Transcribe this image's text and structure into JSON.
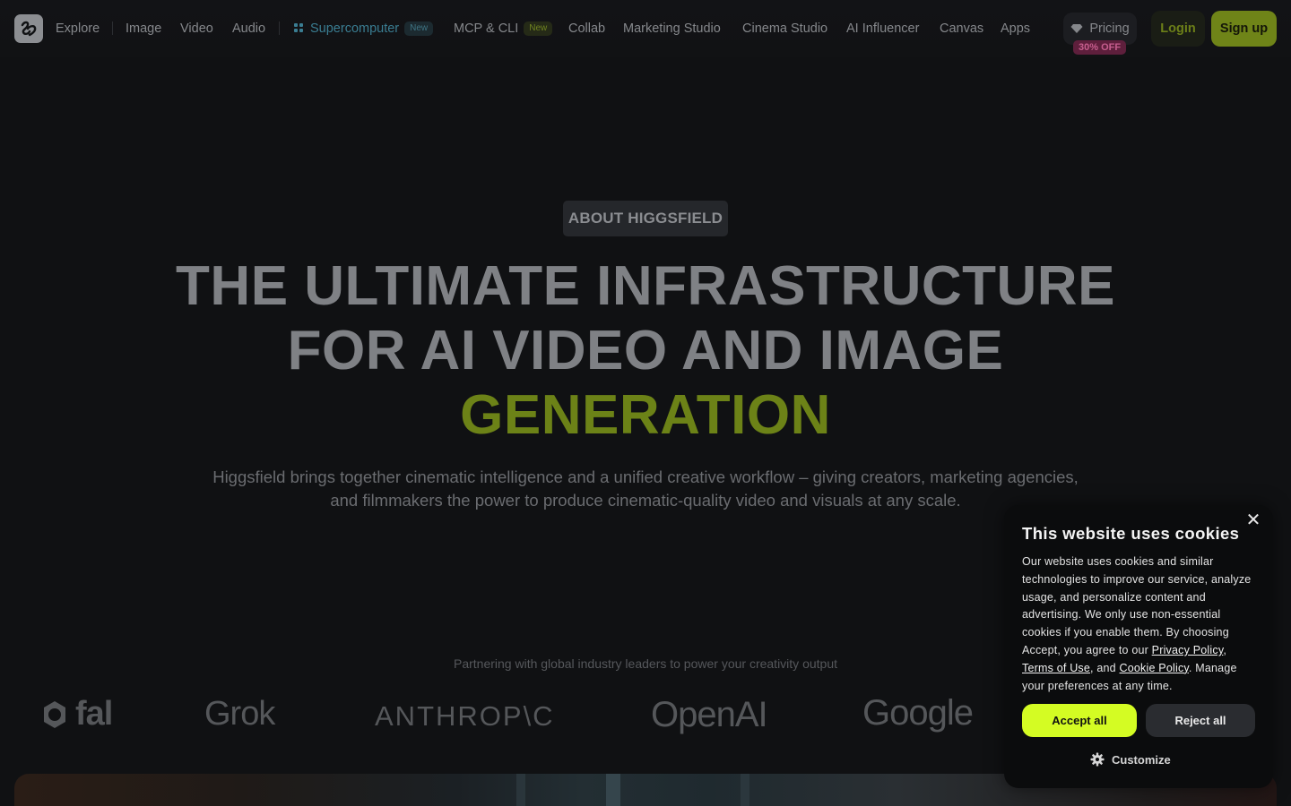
{
  "nav": {
    "items": [
      {
        "label": "Explore"
      },
      {
        "label": "Image"
      },
      {
        "label": "Video"
      },
      {
        "label": "Audio"
      },
      {
        "label": "Supercomputer",
        "badge": "New"
      },
      {
        "label": "MCP & CLI",
        "badge": "New"
      },
      {
        "label": "Collab"
      },
      {
        "label": "Marketing Studio"
      },
      {
        "label": "Cinema Studio"
      },
      {
        "label": "AI Influencer"
      },
      {
        "label": "Canvas"
      },
      {
        "label": "Apps"
      }
    ],
    "pricing_label": "Pricing",
    "discount_badge": "30% OFF",
    "login_label": "Login",
    "signup_label": "Sign up"
  },
  "hero": {
    "tag": "ABOUT HIGGSFIELD",
    "title_line1": "THE ULTIMATE INFRASTRUCTURE",
    "title_line2": "FOR AI VIDEO AND IMAGE",
    "title_accent": "GENERATION",
    "subtitle": "Higgsfield brings together cinematic intelligence and a unified creative workflow – giving creators, marketing agencies, and filmmakers the power to produce cinematic-quality video and visuals at any scale."
  },
  "partners": {
    "caption": "Partnering with global industry leaders to power your creativity output",
    "logos": [
      "fal",
      "Grok",
      "ANTHROP\\C",
      "OpenAI",
      "Google"
    ]
  },
  "cookie": {
    "title": "This website uses cookies",
    "body_part1": "Our website uses cookies and similar technologies to improve our service, analyze usage, and personalize content and advertising. We only use non-essential cookies if you enable them. By choosing Accept, you agree to our ",
    "privacy_link": "Privacy Policy",
    "sep1": ", ",
    "terms_link": "Terms of Use",
    "sep2": ", and ",
    "cookie_link": "Cookie Policy",
    "body_part2": ". Manage your preferences at any time.",
    "accept_label": "Accept all",
    "reject_label": "Reject all",
    "customize_label": "Customize",
    "close_symbol": "✕"
  },
  "colors": {
    "background": "#101113",
    "accent": "#6c8217",
    "cookie_accept": "#d4fc23",
    "supercomputer": "#3a7d92"
  }
}
